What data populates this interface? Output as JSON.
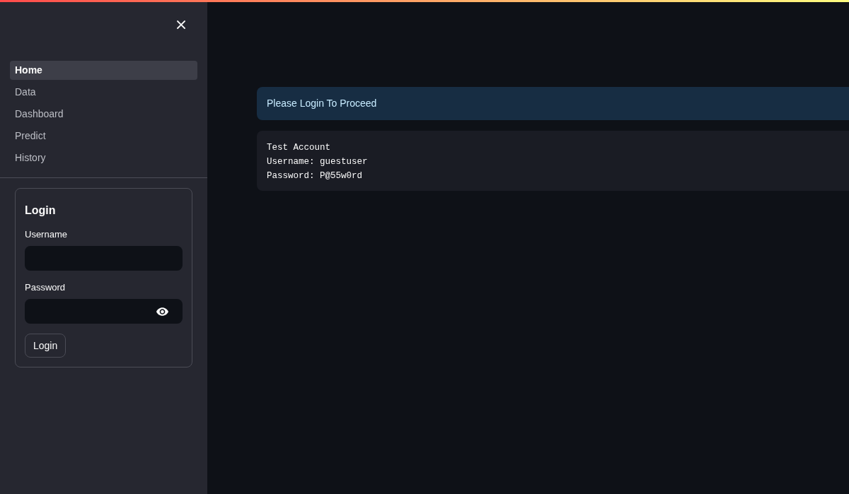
{
  "sidebar": {
    "nav_items": [
      {
        "label": "Home",
        "selected": true
      },
      {
        "label": "Data",
        "selected": false
      },
      {
        "label": "Dashboard",
        "selected": false
      },
      {
        "label": "Predict",
        "selected": false
      },
      {
        "label": "History",
        "selected": false
      }
    ],
    "login_form": {
      "title": "Login",
      "fields": [
        {
          "kind": "text",
          "label": "Username"
        },
        {
          "kind": "password",
          "label": "Password"
        }
      ],
      "button": "Login"
    }
  },
  "main": {
    "info_message": "Please Login To Proceed",
    "code_block": {
      "lines": [
        "Test Account",
        "Username: guestuser",
        "Password: P@55w0rd"
      ]
    }
  }
}
